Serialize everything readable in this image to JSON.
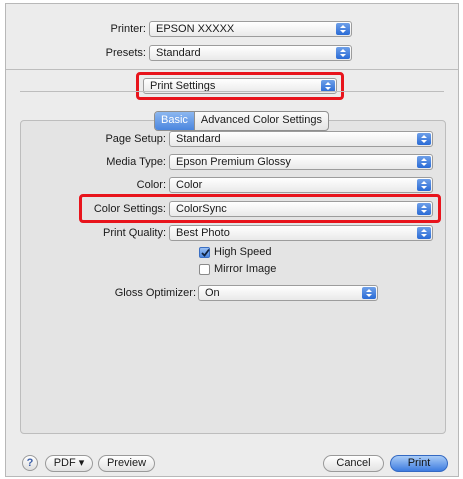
{
  "printer": {
    "label": "Printer:",
    "value": "EPSON XXXXX"
  },
  "presets": {
    "label": "Presets:",
    "value": "Standard"
  },
  "panel_menu": {
    "value": "Print Settings"
  },
  "tabs": {
    "basic": "Basic",
    "advanced": "Advanced Color Settings"
  },
  "fields": {
    "page_setup": {
      "label": "Page Setup:",
      "value": "Standard"
    },
    "media_type": {
      "label": "Media Type:",
      "value": "Epson Premium Glossy"
    },
    "color": {
      "label": "Color:",
      "value": "Color"
    },
    "color_settings": {
      "label": "Color Settings:",
      "value": "ColorSync"
    },
    "print_quality": {
      "label": "Print Quality:",
      "value": "Best Photo"
    },
    "high_speed": {
      "label": "High Speed",
      "checked": true
    },
    "mirror_image": {
      "label": "Mirror Image",
      "checked": false
    },
    "gloss_optimizer": {
      "label": "Gloss Optimizer:",
      "value": "On"
    }
  },
  "footer": {
    "help": "?",
    "pdf": "PDF ▾",
    "preview": "Preview",
    "cancel": "Cancel",
    "print": "Print"
  },
  "highlight_color": "#e8141c",
  "accent_color": "#4b86df"
}
